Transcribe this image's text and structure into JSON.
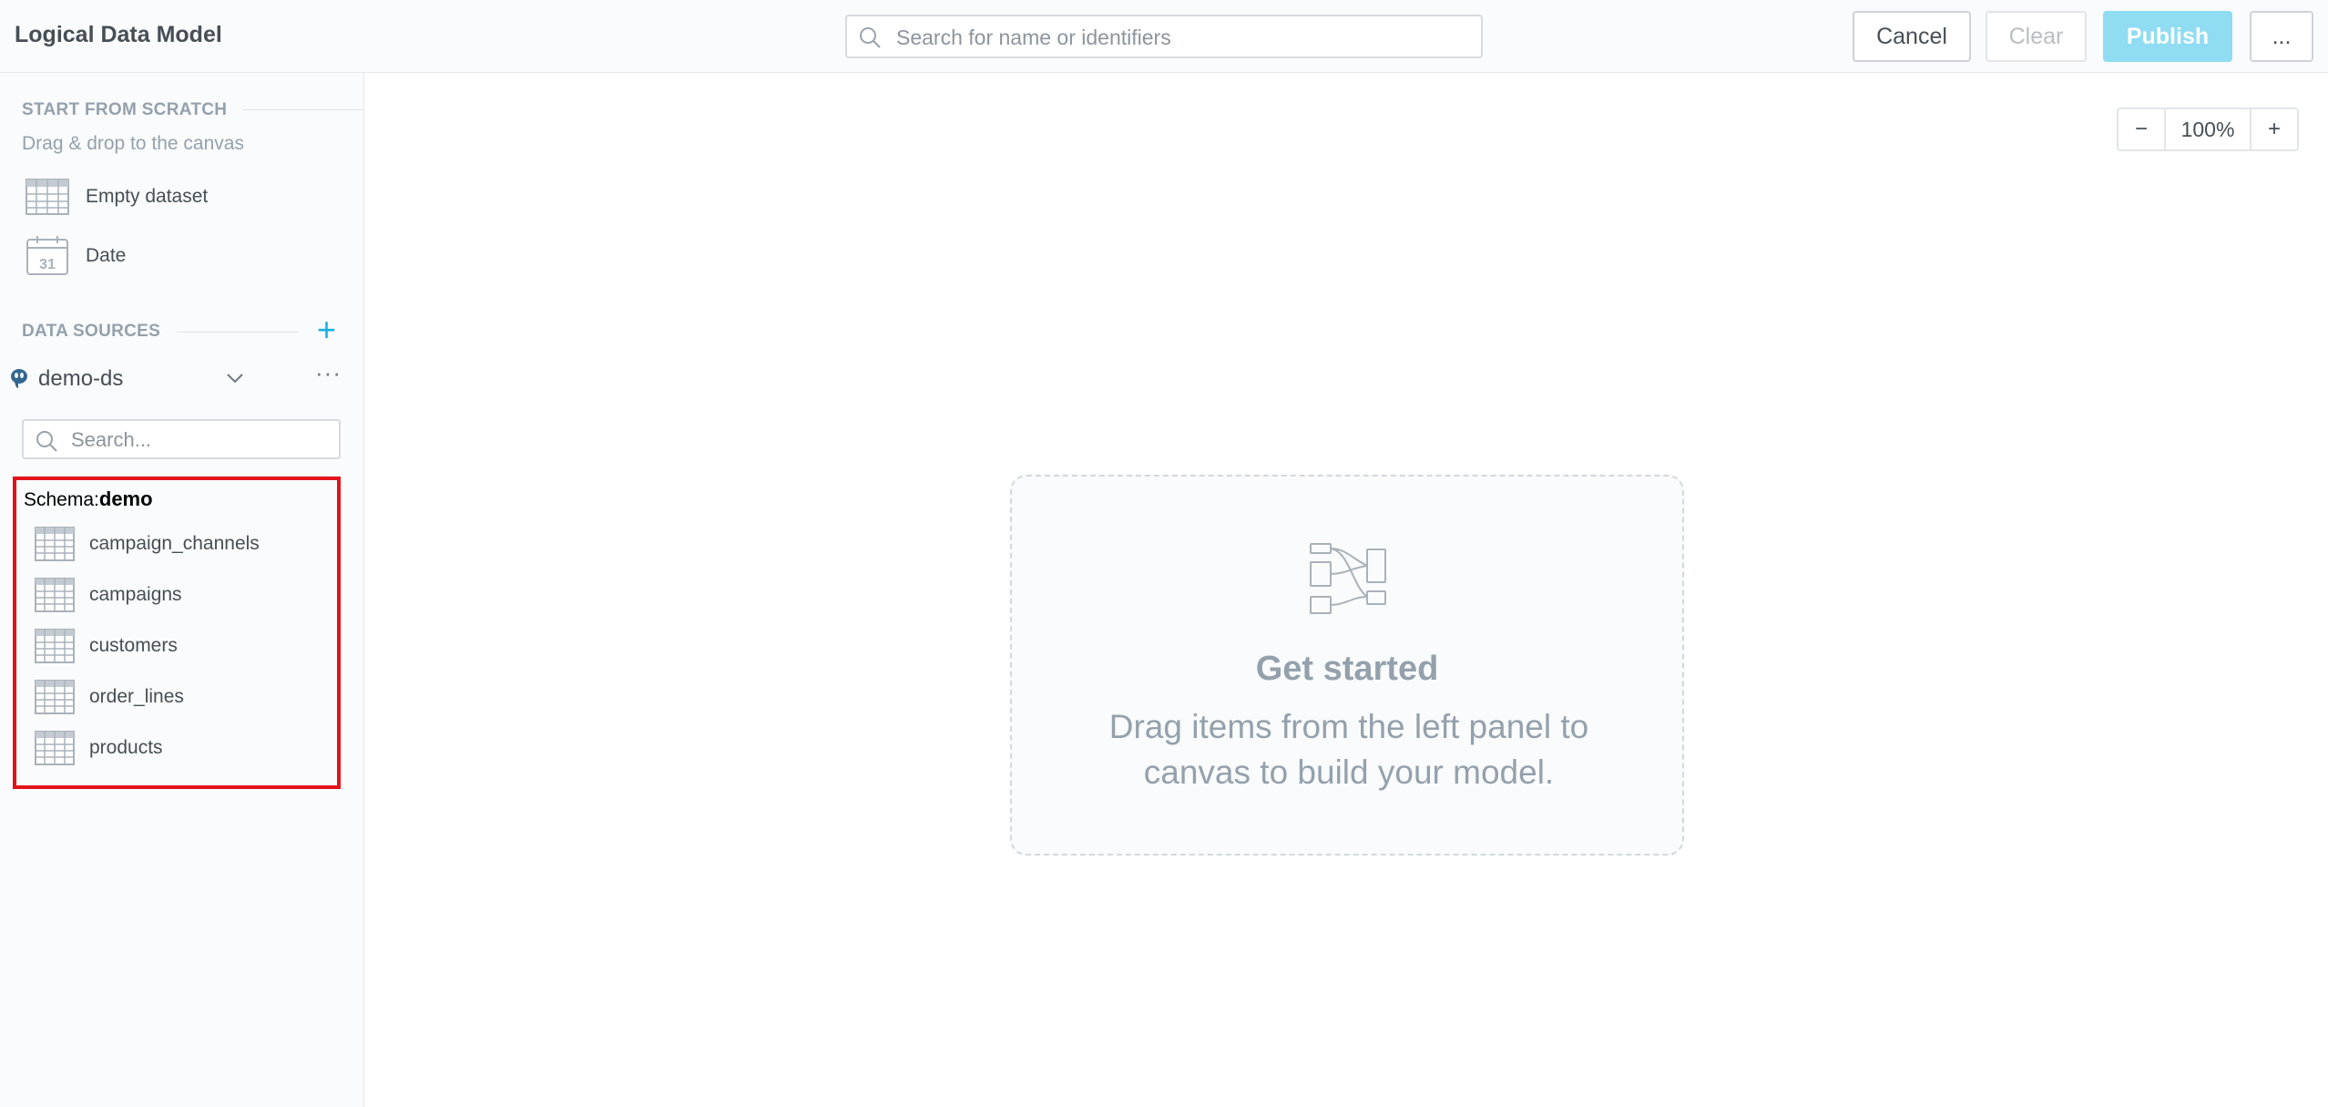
{
  "header": {
    "title": "Logical Data Model",
    "search_placeholder": "Search for name or identifiers",
    "cancel_label": "Cancel",
    "clear_label": "Clear",
    "publish_label": "Publish",
    "more_label": "..."
  },
  "sidebar": {
    "scratch_title": "START FROM SCRATCH",
    "scratch_hint": "Drag & drop to the canvas",
    "scratch_items": [
      {
        "label": "Empty dataset",
        "icon": "table-icon"
      },
      {
        "label": "Date",
        "icon": "calendar-icon"
      }
    ],
    "sources_title": "DATA SOURCES",
    "add_source_label": "+",
    "data_source": {
      "name": "demo-ds",
      "icon": "postgresql-icon"
    },
    "data_source_more": "···",
    "search_placeholder": "Search...",
    "schema_prefix": "Schema:",
    "schema_name": "demo",
    "tables": [
      "campaign_channels",
      "campaigns",
      "customers",
      "order_lines",
      "products"
    ]
  },
  "canvas": {
    "zoom_out_label": "−",
    "zoom_value": "100%",
    "zoom_in_label": "+",
    "empty_title": "Get started",
    "empty_line1": "Drag items from the left panel to",
    "empty_line2": "canvas to build your model."
  },
  "colors": {
    "accent": "#14b2e2",
    "publish_bg": "#8fdcf3",
    "highlight_border": "#e2141b",
    "muted_text": "#94a1ad"
  }
}
